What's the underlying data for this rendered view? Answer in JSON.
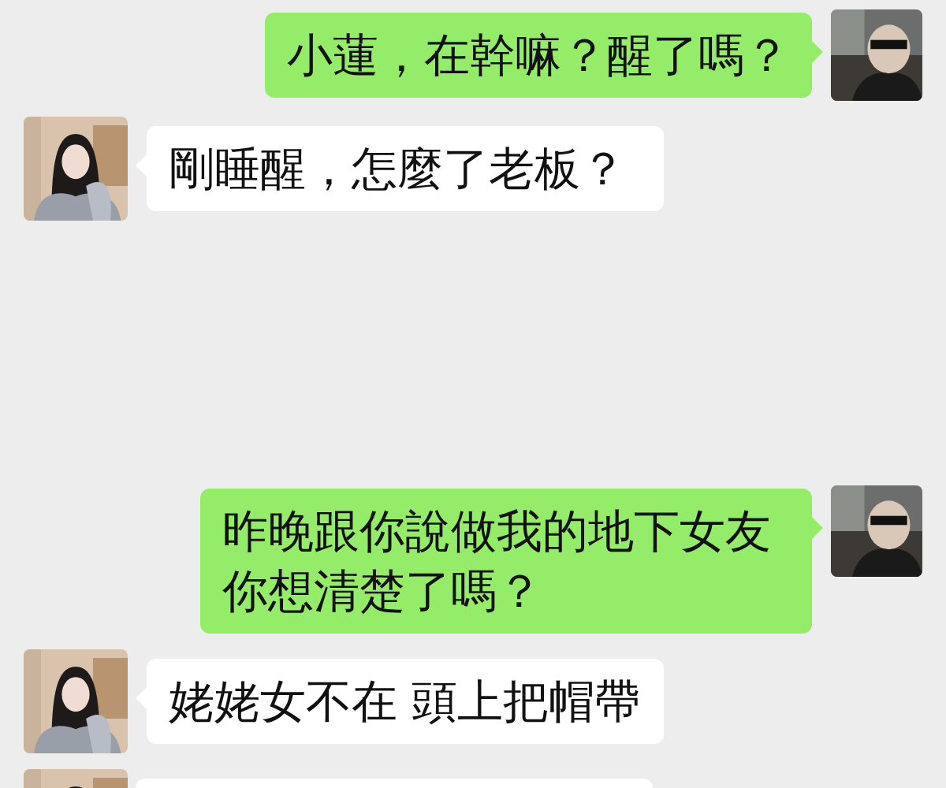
{
  "messages": [
    {
      "kind": "sent",
      "text": "小蓮，在幹嘛？醒了嗎？"
    },
    {
      "kind": "received",
      "text": "剛睡醒，怎麼了老板？"
    },
    {
      "kind": "sent",
      "text": "昨晚跟你說做我的地下女友你想清楚了嗎？"
    },
    {
      "kind": "received",
      "text": "姥姥女不在 頭上把帽帶"
    },
    {
      "kind": "received"
    }
  ]
}
